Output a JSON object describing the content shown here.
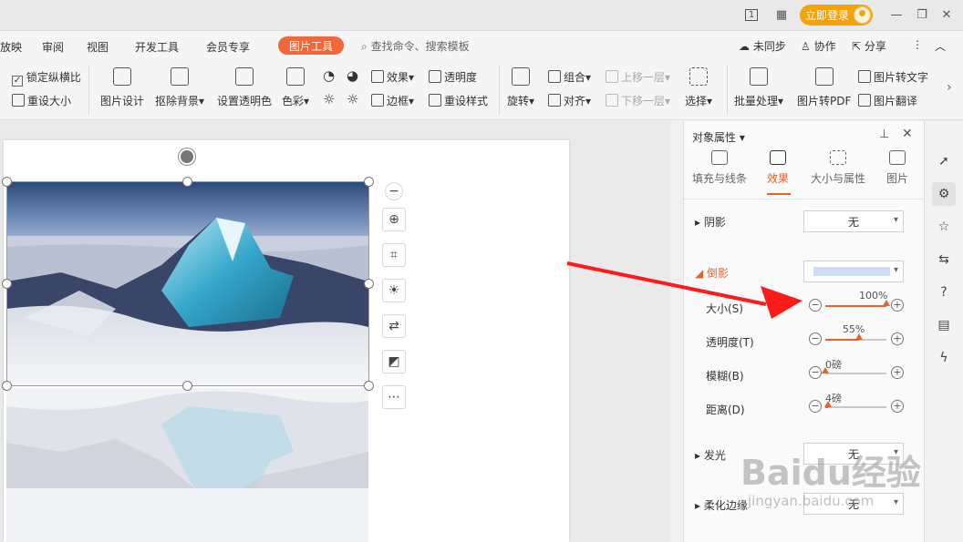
{
  "titlebar": {
    "login_label": "立即登录",
    "icons": [
      "page-number-icon",
      "grid-icon",
      "minimize-icon",
      "restore-icon",
      "close-icon"
    ],
    "page_indicator": "1"
  },
  "menu": {
    "tabs": [
      "放映",
      "审阅",
      "视图",
      "开发工具",
      "会员专享"
    ],
    "active_tab": "图片工具",
    "search_placeholder": "查找命令、搜索模板",
    "unsync": "未同步",
    "collab": "协作",
    "share": "分享"
  },
  "ribbon": {
    "lock_ratio": "锁定纵横比",
    "lock_checked": true,
    "reset_size": "重设大小",
    "picture_design": "图片设计",
    "remove_bg": "抠除背景",
    "set_transparent": "设置透明色",
    "color": "色彩",
    "effect": "效果",
    "transparency": "透明度",
    "border": "边框",
    "reset_style": "重设样式",
    "rotate": "旋转",
    "group": "组合",
    "align": "对齐",
    "bring_forward": "上移一层",
    "send_backward": "下移一层",
    "select": "选择",
    "batch": "批量处理",
    "to_pdf": "图片转PDF",
    "to_text": "图片转文字",
    "translate": "图片翻译"
  },
  "panel": {
    "title": "对象属性",
    "tabs": [
      {
        "label": "填充与线条",
        "icon": "fill-bucket-icon"
      },
      {
        "label": "效果",
        "icon": "effect-icon"
      },
      {
        "label": "大小与属性",
        "icon": "size-icon"
      },
      {
        "label": "图片",
        "icon": "picture-icon"
      }
    ],
    "active_tab": "效果",
    "shadow": {
      "label": "阴影",
      "value": "无"
    },
    "reflection": {
      "label": "倒影",
      "size": {
        "label": "大小(S)",
        "value": "100%",
        "percent": 100
      },
      "transparency": {
        "label": "透明度(T)",
        "value": "55%",
        "percent": 55
      },
      "blur": {
        "label": "模糊(B)",
        "value": "0磅",
        "percent": 0
      },
      "distance": {
        "label": "距离(D)",
        "value": "4磅",
        "percent": 4
      }
    },
    "glow": {
      "label": "发光",
      "value": "无"
    },
    "soft_edge": {
      "label": "柔化边缘",
      "value": "无"
    }
  },
  "strip": {
    "icons": [
      "rocket-icon",
      "adjust-icon",
      "star-pin-icon",
      "convert-icon",
      "help-icon",
      "table-tool-icon",
      "power-icon"
    ]
  },
  "colors": {
    "accent": "#e8622e",
    "login": "#f6a20a",
    "arrow": "#ff1a1a"
  },
  "watermark": {
    "text": "Baidu经验",
    "sub": "jingyan.baidu.com"
  }
}
